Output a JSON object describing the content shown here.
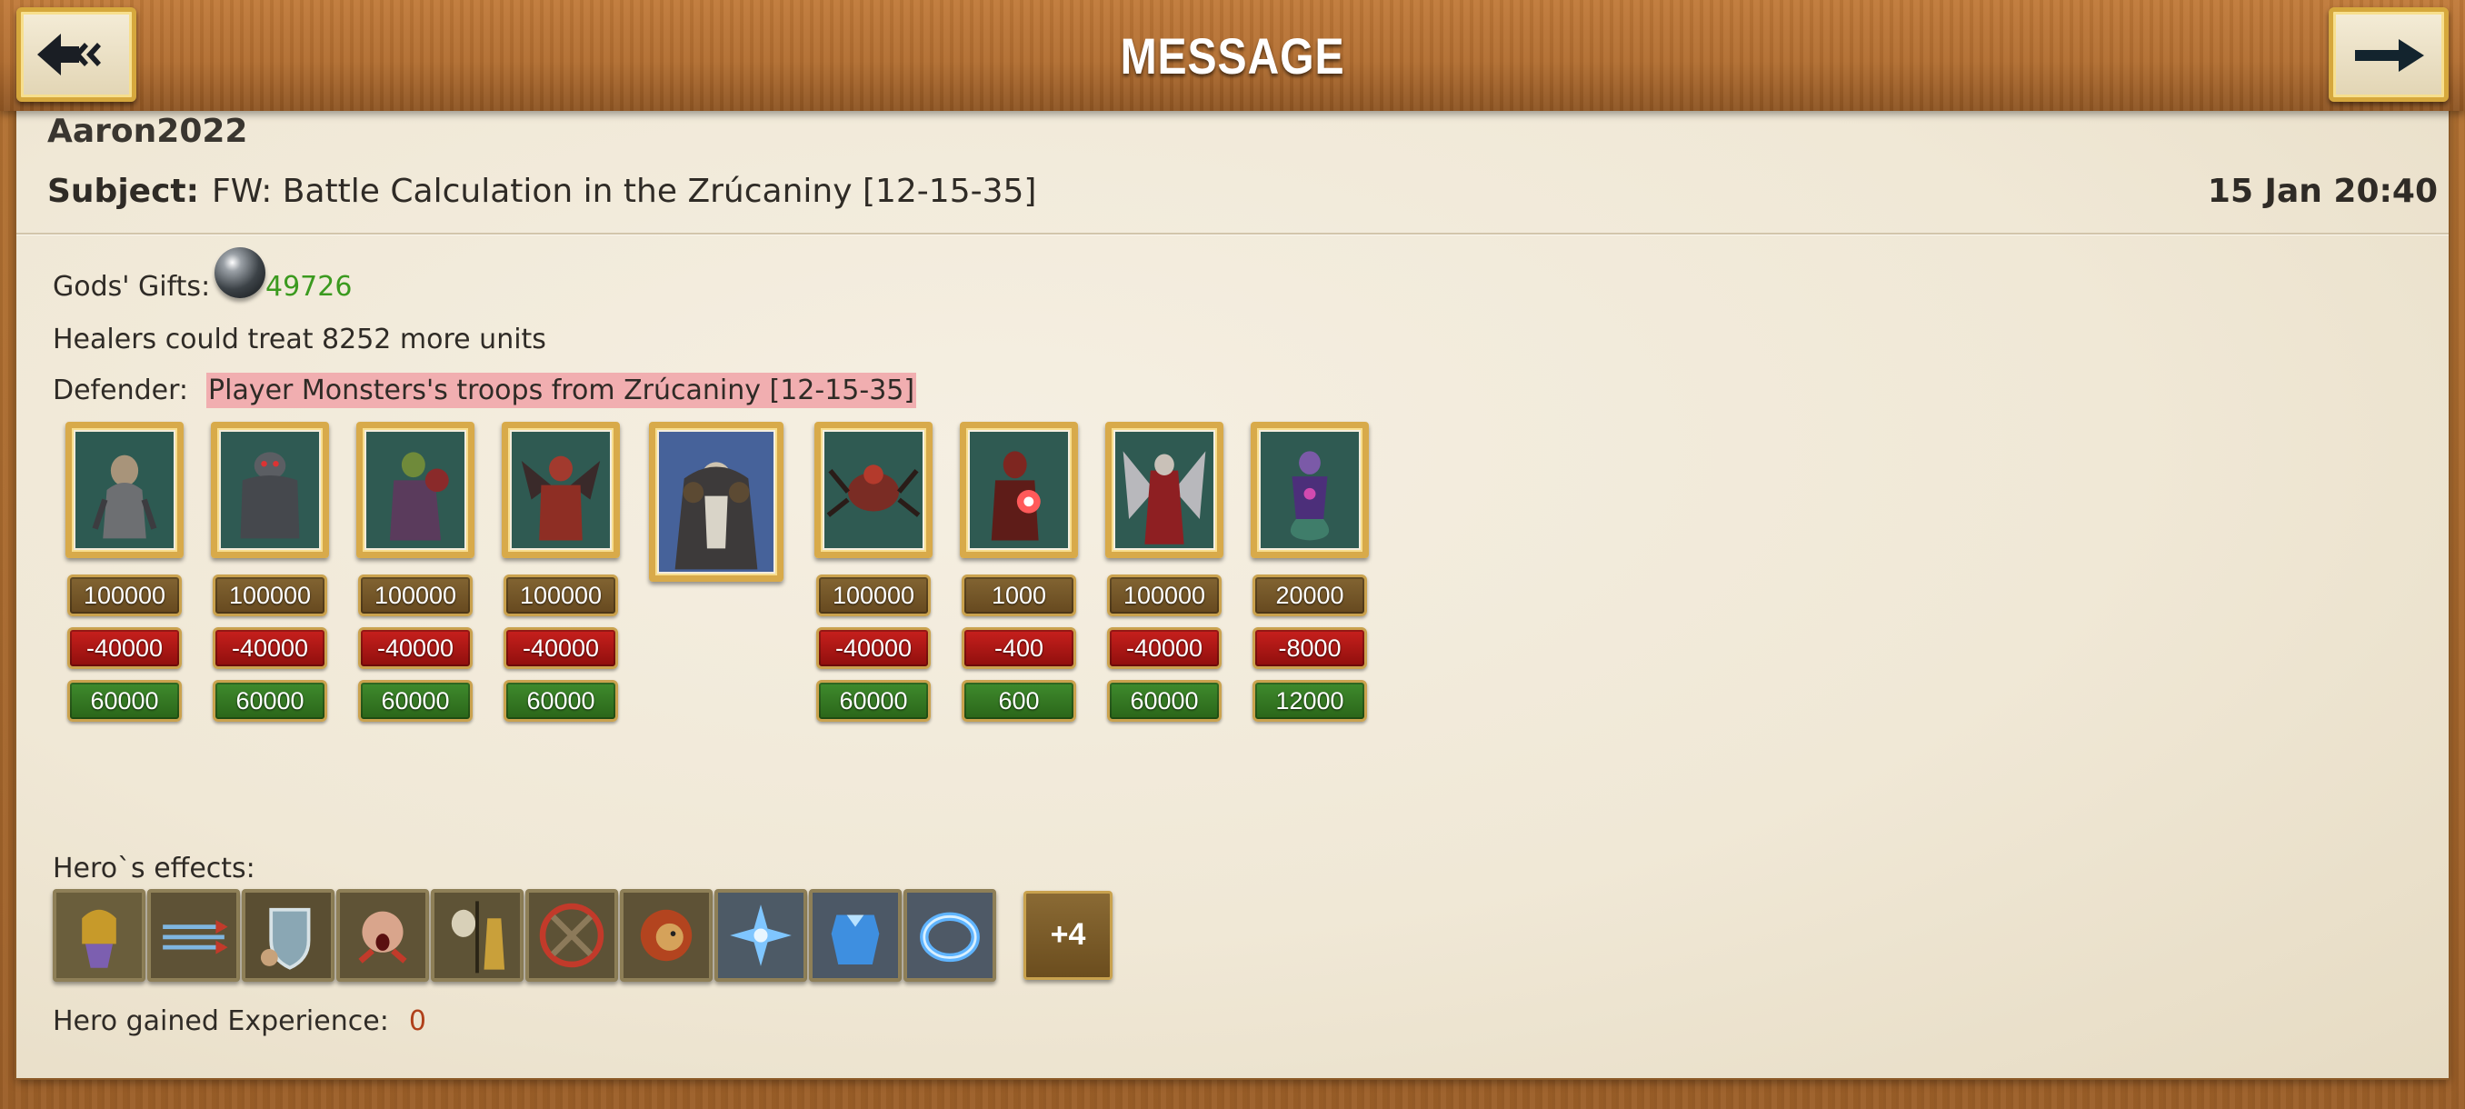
{
  "header": {
    "title": "MESSAGE",
    "back_icon": "back-arrow-icon",
    "forward_icon": "forward-arrow-icon"
  },
  "message": {
    "sender": "Aaron2022",
    "subject_label": "Subject:",
    "subject": "FW: Battle Calculation in the Zrúcaniny [12-15-35]",
    "date": "15 Jan 20:40"
  },
  "report": {
    "gods_gifts_label": "Gods' Gifts:",
    "gods_gifts_value": "49726",
    "healers_text": "Healers could treat 8252 more units",
    "defender_label": "Defender:",
    "defender_name": "Player Monsters's troops from Zrúcaniny [12-15-35]",
    "hero_portrait": "hero-portrait",
    "troops": [
      {
        "icon": "lizard-warrior-icon",
        "count": "100000",
        "loss": "-40000",
        "remaining": "60000"
      },
      {
        "icon": "stone-golem-icon",
        "count": "100000",
        "loss": "-40000",
        "remaining": "60000"
      },
      {
        "icon": "orc-shaman-icon",
        "count": "100000",
        "loss": "-40000",
        "remaining": "60000"
      },
      {
        "icon": "red-demon-icon",
        "count": "100000",
        "loss": "-40000",
        "remaining": "60000"
      },
      {
        "icon": "spider-beast-icon",
        "count": "100000",
        "loss": "-40000",
        "remaining": "60000"
      },
      {
        "icon": "fire-demon-icon",
        "count": "1000",
        "loss": "-400",
        "remaining": "600"
      },
      {
        "icon": "winged-wraith-icon",
        "count": "100000",
        "loss": "-40000",
        "remaining": "60000"
      },
      {
        "icon": "naga-sorceress-icon",
        "count": "20000",
        "loss": "-8000",
        "remaining": "12000"
      }
    ],
    "hero_effects_label": "Hero`s effects:",
    "hero_effects": [
      "helmet-hand-icon",
      "arrow-volley-icon",
      "shield-icon",
      "screaming-face-icon",
      "skull-statue-icon",
      "crossed-hammers-icon",
      "lion-head-icon",
      "ice-star-icon",
      "ice-armor-icon",
      "ice-ring-icon"
    ],
    "more_effects": "+4",
    "experience_label": "Hero gained Experience:",
    "experience_value": "0"
  },
  "colors": {
    "loss": "#b0171a",
    "remaining": "#35781f",
    "count": "#7a5a2a",
    "gift_value": "#3b9a1f",
    "defender_highlight": "#f1aeb0",
    "gold_frame": "#d8aa4a"
  }
}
